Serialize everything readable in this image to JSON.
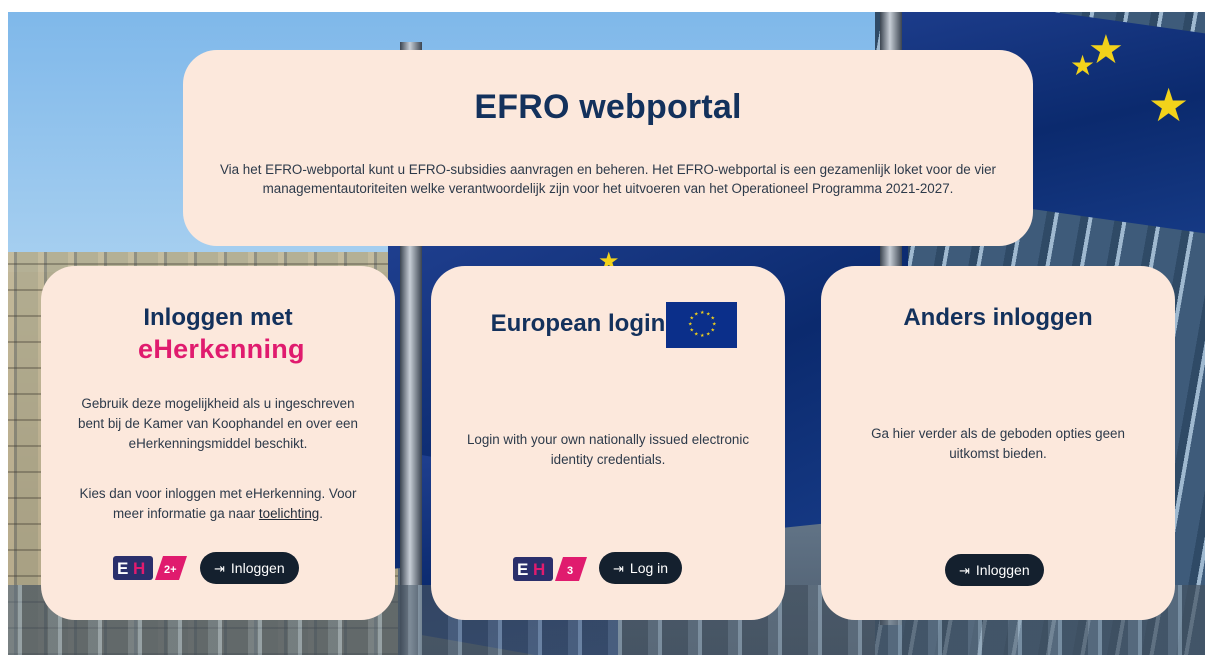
{
  "hero": {
    "title": "EFRO webportal",
    "description": "Via het EFRO-webportal kunt u EFRO-subsidies aanvragen en beheren. Het EFRO-webportal is een gezamenlijk loket voor de vier managementautoriteiten welke verantwoordelijk zijn voor het uitvoeren van het Operationeel Programma 2021-2027."
  },
  "cards": {
    "eherkenning": {
      "title": "Inloggen met",
      "logo_text": "eHerkenning",
      "text1": "Gebruik deze mogelijkheid als u ingeschreven bent bij de Kamer van Koophandel en over een eHerkenningsmiddel beschikt.",
      "text2_prefix": "Kies dan voor inloggen met eHerkenning. Voor meer informatie ga naar ",
      "text2_link": "toelichting",
      "text2_suffix": ".",
      "badge_level": "2+",
      "button_label": "Inloggen"
    },
    "european": {
      "title": "European login",
      "text": "Login with your own nationally issued electronic identity credentials.",
      "badge_level": "3",
      "button_label": "Log in"
    },
    "other": {
      "title": "Anders inloggen",
      "text": "Ga hier verder als de geboden opties geen uitkomst bieden.",
      "button_label": "Inloggen"
    }
  },
  "colors": {
    "card_bg": "#fce8dc",
    "title_navy": "#13315c",
    "button_bg": "#14202e",
    "eh_pink": "#e01b6e",
    "eu_blue": "#0b2f8a",
    "eu_star": "#f2d21a"
  },
  "icons": {
    "login": "login-arrow-icon",
    "eu_flag": "eu-flag-icon",
    "eh_badge": "eherkenning-badge-icon"
  }
}
